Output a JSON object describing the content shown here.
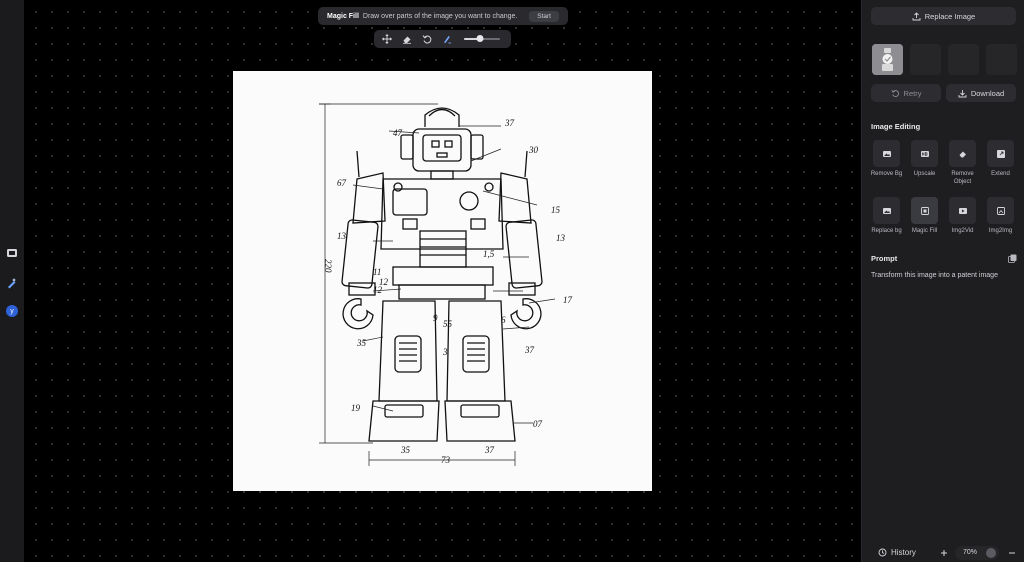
{
  "hint": {
    "title": "Magic Fill",
    "text": "Draw over parts of the image you want to change.",
    "start_label": "Start"
  },
  "toolbar": {
    "tools": [
      "move-icon",
      "eraser-icon",
      "undo-icon",
      "brush-icon"
    ],
    "brush_size": 0.45
  },
  "image": {
    "labels": [
      "47",
      "37",
      "30",
      "67",
      "15",
      "13",
      "13",
      "220",
      "12",
      "1,5",
      "11",
      "12",
      "9",
      "55",
      "6",
      "17",
      "35",
      "3",
      "37",
      "19",
      "07",
      "35",
      "73",
      "37"
    ]
  },
  "panel": {
    "replace_image_label": "Replace Image",
    "retry_label": "Retry",
    "download_label": "Download",
    "section_title": "Image Editing",
    "tools": [
      {
        "label": "Remove Bg"
      },
      {
        "label": "Upscale"
      },
      {
        "label": "Remove Object"
      },
      {
        "label": "Extend"
      },
      {
        "label": "Replace bg"
      },
      {
        "label": "Magic Fill"
      },
      {
        "label": "Img2Vid"
      },
      {
        "label": "Img2Img"
      }
    ],
    "prompt_title": "Prompt",
    "prompt_text": "Transform this image into a patent image"
  },
  "footer": {
    "history_label": "History",
    "zoom_level": "70%"
  },
  "colors": {
    "canvas_bg": "#000000",
    "panel_bg": "#1e1e21",
    "avatar_bg": "#2f62d6",
    "text": "#d6d6dc"
  }
}
